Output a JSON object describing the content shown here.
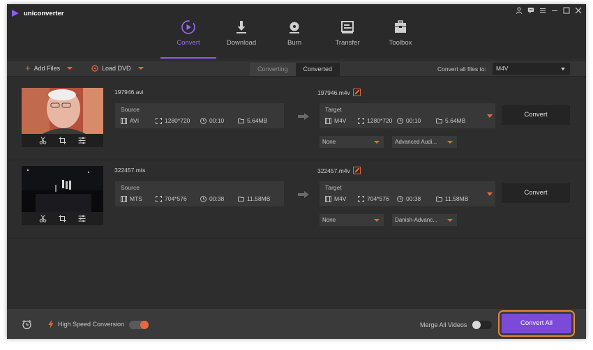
{
  "app": {
    "title": "uniconverter",
    "window_controls": [
      "user-icon",
      "message-icon",
      "menu-icon",
      "minimize-icon",
      "maximize-icon",
      "close-icon"
    ]
  },
  "nav": {
    "tabs": [
      {
        "label": "Convert",
        "icon": "convert-icon",
        "active": true
      },
      {
        "label": "Download",
        "icon": "download-icon",
        "active": false
      },
      {
        "label": "Burn",
        "icon": "burn-icon",
        "active": false
      },
      {
        "label": "Transfer",
        "icon": "transfer-icon",
        "active": false
      },
      {
        "label": "Toolbox",
        "icon": "toolbox-icon",
        "active": false
      }
    ]
  },
  "toolbar": {
    "add_files": "Add Files",
    "load_dvd": "Load DVD",
    "segment": [
      "Converting",
      "Converted"
    ],
    "segment_active": "Converted",
    "convert_all_label": "Convert all files to:",
    "convert_all_value": "M4V"
  },
  "files": [
    {
      "source_name": "197946.avi",
      "target_name": "197946.m4v",
      "source": {
        "title": "Source",
        "format": "AVI",
        "resolution": "1280*720",
        "duration": "00:10",
        "size": "5.64MB"
      },
      "target": {
        "title": "Target",
        "format": "M4V",
        "resolution": "1280*720",
        "duration": "00:10",
        "size": "5.64MB"
      },
      "subtitle": "None",
      "audio": "Advanced Audi...",
      "convert_label": "Convert"
    },
    {
      "source_name": "322457.mts",
      "target_name": "322457.m4v",
      "source": {
        "title": "Source",
        "format": "MTS",
        "resolution": "704*576",
        "duration": "00:38",
        "size": "11.58MB"
      },
      "target": {
        "title": "Target",
        "format": "M4V",
        "resolution": "704*576",
        "duration": "00:38",
        "size": "11.58MB"
      },
      "subtitle": "None",
      "audio": "Danish-Advanc...",
      "convert_label": "Convert"
    }
  ],
  "bottom": {
    "high_speed_label": "High Speed Conversion",
    "high_speed_on": true,
    "merge_label": "Merge All Videos",
    "merge_on": false,
    "convert_all_button": "Convert All"
  },
  "colors": {
    "accent_purple": "#8b5cf6",
    "accent_orange": "#e8673f",
    "convert_all_bg": "#7c4ad8",
    "window_bg": "#2d2d2d"
  }
}
